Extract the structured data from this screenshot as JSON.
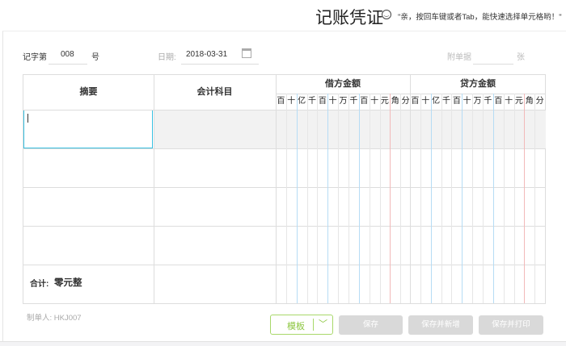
{
  "header": {
    "title": "记账凭证",
    "tip": "\"亲，按回车键或者Tab，能快速选择单元格哟！\""
  },
  "form": {
    "voucher_prefix": "记字第",
    "voucher_no": "008",
    "voucher_suffix": "号",
    "date_label": "日期:",
    "date_value": "2018-03-31",
    "attach_label": "附单据",
    "attach_value": "",
    "attach_suffix": "张"
  },
  "table": {
    "col_summary": "摘要",
    "col_account": "会计科目",
    "col_debit": "借方金额",
    "col_credit": "贷方金额",
    "digits": [
      "百",
      "十",
      "亿",
      "千",
      "百",
      "十",
      "万",
      "千",
      "百",
      "十",
      "元",
      "角",
      "分"
    ],
    "rows": 4,
    "total_label": "合计:",
    "total_value": "零元整"
  },
  "footer": {
    "maker": "制单人: HKJ007",
    "template": "模板",
    "save": "保存",
    "save_new": "保存并新增",
    "save_print": "保存并打印"
  },
  "colors": {
    "accent": "#8cc63f",
    "active": "#38c0e0",
    "blue_line": "#b6dcf5",
    "red_line": "#f2b9b9"
  }
}
